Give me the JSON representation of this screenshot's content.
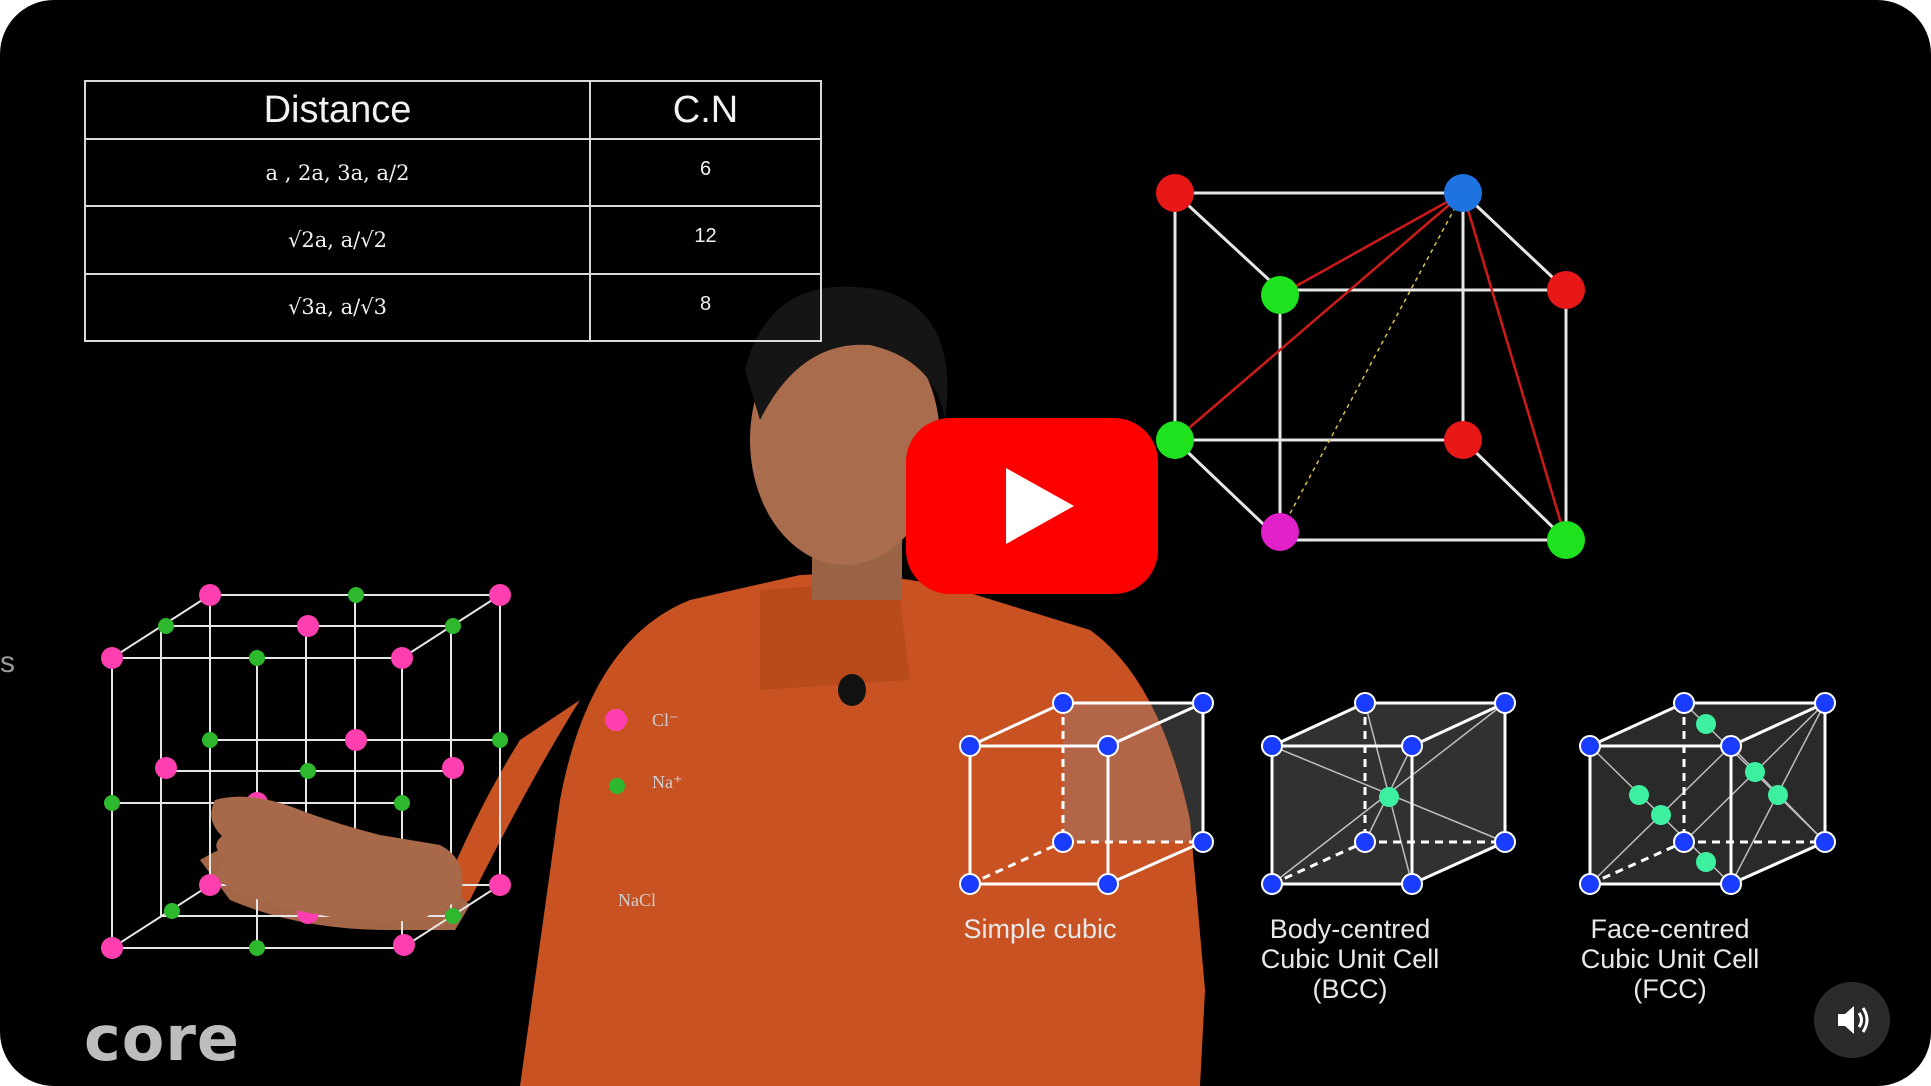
{
  "video": {
    "table": {
      "headers": [
        "Distance",
        "C.N"
      ],
      "rows": [
        {
          "distance": "a , 2a, 3a, a/2",
          "cn": "6"
        },
        {
          "distance": "√2a, a/√2",
          "cn": "12"
        },
        {
          "distance": "√3a, a/√3",
          "cn": "8"
        }
      ]
    },
    "nacl_legend": {
      "cl": "Cl⁻",
      "na": "Na⁺",
      "caption": "NaCl"
    },
    "unit_cells": {
      "simple": "Simple cubic",
      "bcc": [
        "Body-centred",
        "Cubic Unit Cell",
        "(BCC)"
      ],
      "fcc": [
        "Face-centred",
        "Cubic Unit Cell",
        "(FCC)"
      ]
    },
    "edge_text": "s",
    "logo": "core",
    "colors": {
      "cl_ion": "#ff3fb0",
      "na_ion": "#2db82d",
      "atom_red": "#e81818",
      "atom_blue": "#1f73e0",
      "atom_green": "#1ee21e",
      "atom_magenta": "#e020c8",
      "unit_atom": "#1a3cff",
      "center_atom": "#3cf0a0",
      "shirt": "#d85a22",
      "play": "#ff0000"
    }
  },
  "controls": {
    "play_icon": "play-icon",
    "volume_icon": "speaker-volume-icon"
  }
}
